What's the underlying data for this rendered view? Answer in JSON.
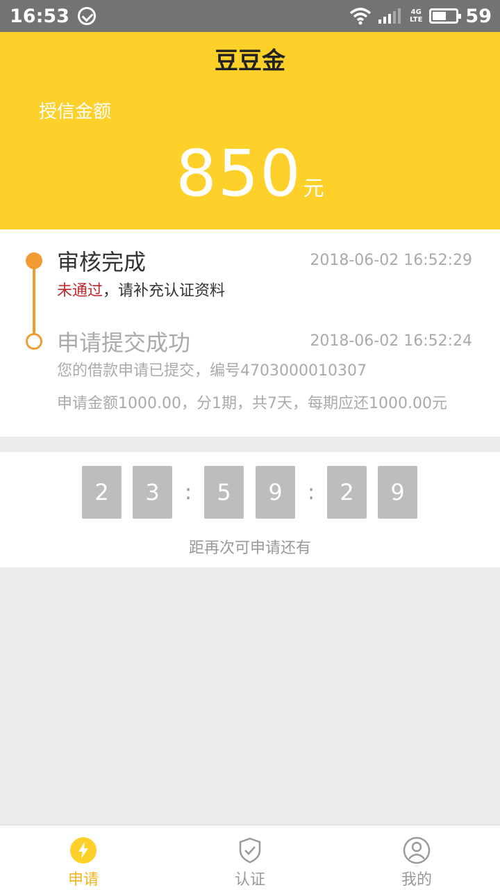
{
  "status_bar": {
    "time": "16:53",
    "network": "4G\nLTE",
    "battery_percent": "59",
    "battery_level": 0.59
  },
  "header": {
    "title": "豆豆金",
    "credit_label": "授信金额",
    "credit_amount": "850",
    "credit_unit": "元",
    "background_color": "#fdd02a"
  },
  "timeline": {
    "accent_color": "#f29b33",
    "steps": [
      {
        "title": "审核完成",
        "time": "2018-06-02 16:52:29",
        "status": "未通过",
        "message": "，请补充认证资料"
      },
      {
        "title": "申请提交成功",
        "time": "2018-06-02 16:52:24",
        "line1": "您的借款申请已提交，编号4703000010307",
        "line2": "申请金额1000.00，分1期，共7天，每期应还1000.00元"
      }
    ]
  },
  "countdown": {
    "digits": [
      "2",
      "3",
      "5",
      "9",
      "2",
      "9"
    ],
    "separator": ":",
    "caption": "距再次可申请还有"
  },
  "bottom_nav": {
    "active_color": "#f5b41e",
    "items": [
      {
        "label": "申请",
        "icon": "lightning-icon",
        "active": true
      },
      {
        "label": "认证",
        "icon": "shield-check-icon",
        "active": false
      },
      {
        "label": "我的",
        "icon": "user-icon",
        "active": false
      }
    ]
  }
}
